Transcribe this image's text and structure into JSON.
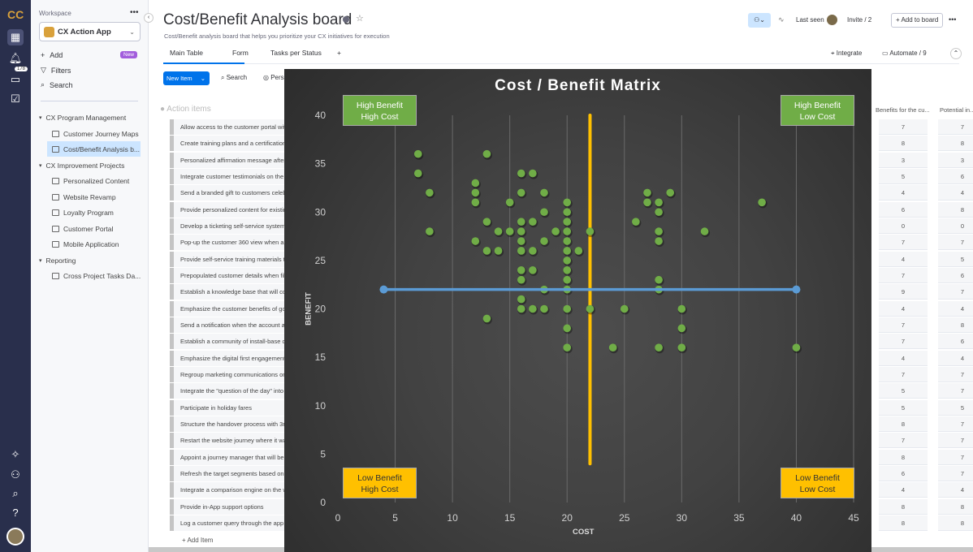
{
  "rail": {
    "notifications_badge": "178",
    "icons": [
      "logo",
      "apps-grid-icon",
      "bell-icon",
      "inbox-icon",
      "calendar-check-icon",
      "puzzle-icon",
      "add-user-icon",
      "search-icon",
      "help-icon",
      "avatar"
    ]
  },
  "workspace": {
    "label": "Workspace",
    "name": "CX Action App",
    "add": "Add",
    "new_badge": "New",
    "filters": "Filters",
    "search": "Search",
    "tree": [
      {
        "type": "folder",
        "label": "CX Program Management"
      },
      {
        "type": "board",
        "label": "Customer Journey Maps"
      },
      {
        "type": "board",
        "label": "Cost/Benefit Analysis b...",
        "selected": true
      },
      {
        "type": "folder",
        "label": "CX Improvement Projects"
      },
      {
        "type": "board",
        "label": "Personalized Content"
      },
      {
        "type": "board",
        "label": "Website Revamp"
      },
      {
        "type": "board",
        "label": "Loyalty Program"
      },
      {
        "type": "board",
        "label": "Customer Portal"
      },
      {
        "type": "board",
        "label": "Mobile Application"
      },
      {
        "type": "folder",
        "label": "Reporting"
      },
      {
        "type": "dashboard",
        "label": "Cross Project Tasks Da..."
      }
    ]
  },
  "header": {
    "title": "Cost/Benefit Analysis board",
    "description": "Cost/Benefit analysis board that helps you prioritize your CX initiatives for execution",
    "last_seen": "Last seen",
    "invite": "Invite / 2",
    "add_to_board": "+ Add to board",
    "integrate": "Integrate",
    "automate": "Automate / 9",
    "tabs": [
      {
        "label": "Main Table",
        "active": true
      },
      {
        "label": "Form"
      },
      {
        "label": "Tasks per Status"
      },
      {
        "label": "+"
      }
    ]
  },
  "toolbar": {
    "new_item": "New Item",
    "search": "Search",
    "person": "Person"
  },
  "table": {
    "group": "Action items",
    "columns": [
      "Benefits for the cu...",
      "Potential in..."
    ],
    "add_item": "+ Add Item",
    "rows": [
      [
        "Allow access to the customer portal with",
        "7",
        "7"
      ],
      [
        "Create training plans and a certification",
        "8",
        "8"
      ],
      [
        "Personalized affirmation message after",
        "3",
        "3"
      ],
      [
        "Integrate customer testimonials on the",
        "5",
        "6"
      ],
      [
        "Send a branded gift to customers celeb",
        "4",
        "4"
      ],
      [
        "Provide personalized content for existin",
        "6",
        "8"
      ],
      [
        "Develop a ticketing self-service system",
        "0",
        "0"
      ],
      [
        "Pop-up the customer 360 view when an",
        "7",
        "7"
      ],
      [
        "Provide self-service training materials t",
        "4",
        "5"
      ],
      [
        "Prepopulated customer details when fill",
        "7",
        "6"
      ],
      [
        "Establish a knowledge base that will co",
        "9",
        "7"
      ],
      [
        "Emphasize the customer benefits of go",
        "4",
        "4"
      ],
      [
        "Send a notification when the account ac",
        "7",
        "8"
      ],
      [
        "Establish a community of install-base c",
        "7",
        "6"
      ],
      [
        "Emphasize the digital first engagement",
        "4",
        "4"
      ],
      [
        "Regroup marketing communications on",
        "7",
        "7"
      ],
      [
        "Integrate the \"question of the day\" into t",
        "5",
        "7"
      ],
      [
        "Participate in holiday fares",
        "5",
        "5"
      ],
      [
        "Structure the handover process with 3rd",
        "8",
        "7"
      ],
      [
        "Restart the website journey where it wa",
        "7",
        "7"
      ],
      [
        "Appoint a journey manager that will be",
        "8",
        "7"
      ],
      [
        "Refresh the target segments based on t",
        "6",
        "7"
      ],
      [
        "Integrate a comparison engine on the w",
        "4",
        "4"
      ],
      [
        "Provide in-App support options",
        "8",
        "8"
      ],
      [
        "Log a customer query through the app c",
        "8",
        "8"
      ]
    ]
  },
  "chart_data": {
    "type": "scatter",
    "title": "Cost / Benefit Matrix",
    "xlabel": "COST",
    "ylabel": "BENEFIT",
    "xlim": [
      0,
      45
    ],
    "ylim": [
      0,
      40
    ],
    "xticks": [
      "0",
      "5",
      "10",
      "15",
      "20",
      "25",
      "30",
      "35",
      "40",
      "45"
    ],
    "yticks": [
      "0",
      "5",
      "10",
      "15",
      "20",
      "25",
      "30",
      "35",
      "40"
    ],
    "grid": "vertical",
    "point_color": "#70ad47",
    "points": [
      [
        7,
        36
      ],
      [
        7,
        34
      ],
      [
        8,
        32
      ],
      [
        8,
        28
      ],
      [
        13,
        36
      ],
      [
        12,
        33
      ],
      [
        12,
        32
      ],
      [
        12,
        31
      ],
      [
        16,
        34
      ],
      [
        17,
        34
      ],
      [
        16,
        32
      ],
      [
        18,
        32
      ],
      [
        15,
        31
      ],
      [
        18,
        30
      ],
      [
        20,
        31
      ],
      [
        20,
        30
      ],
      [
        20,
        29
      ],
      [
        20,
        28
      ],
      [
        20,
        27
      ],
      [
        20,
        26
      ],
      [
        20,
        25
      ],
      [
        13,
        29
      ],
      [
        16,
        29
      ],
      [
        17,
        29
      ],
      [
        12,
        27
      ],
      [
        14,
        28
      ],
      [
        15,
        28
      ],
      [
        16,
        28
      ],
      [
        19,
        28
      ],
      [
        16,
        27
      ],
      [
        16,
        26
      ],
      [
        13,
        26
      ],
      [
        14,
        26
      ],
      [
        18,
        27
      ],
      [
        17,
        26
      ],
      [
        21,
        26
      ],
      [
        22,
        28
      ],
      [
        16,
        24
      ],
      [
        16,
        23
      ],
      [
        17,
        24
      ],
      [
        20,
        24
      ],
      [
        20,
        23
      ],
      [
        18,
        22
      ],
      [
        20,
        22
      ],
      [
        16,
        21
      ],
      [
        16,
        20
      ],
      [
        17,
        20
      ],
      [
        18,
        20
      ],
      [
        20,
        20
      ],
      [
        22,
        20
      ],
      [
        25,
        20
      ],
      [
        13,
        19
      ],
      [
        20,
        18
      ],
      [
        20,
        16
      ],
      [
        24,
        16
      ],
      [
        27,
        32
      ],
      [
        29,
        32
      ],
      [
        27,
        31
      ],
      [
        28,
        31
      ],
      [
        37,
        31
      ],
      [
        28,
        30
      ],
      [
        26,
        29
      ],
      [
        28,
        28
      ],
      [
        32,
        28
      ],
      [
        28,
        27
      ],
      [
        28,
        23
      ],
      [
        28,
        22
      ],
      [
        30,
        20
      ],
      [
        30,
        18
      ],
      [
        28,
        16
      ],
      [
        30,
        16
      ],
      [
        40,
        16
      ]
    ],
    "vertical_line": {
      "x": 22,
      "y": [
        4,
        40
      ],
      "color": "#ffc000"
    },
    "horizontal_line": {
      "y": 22,
      "x": [
        4,
        40
      ],
      "color": "#5b9bd5"
    },
    "quadrants": [
      {
        "line1": "High Benefit",
        "line2": "High Cost",
        "color": "#70ad47"
      },
      {
        "line1": "High Benefit",
        "line2": "Low Cost",
        "color": "#70ad47"
      },
      {
        "line1": "Low Benefit",
        "line2": "High Cost",
        "color": "#ffc000"
      },
      {
        "line1": "Low Benefit",
        "line2": "Low Cost",
        "color": "#ffc000"
      }
    ]
  }
}
